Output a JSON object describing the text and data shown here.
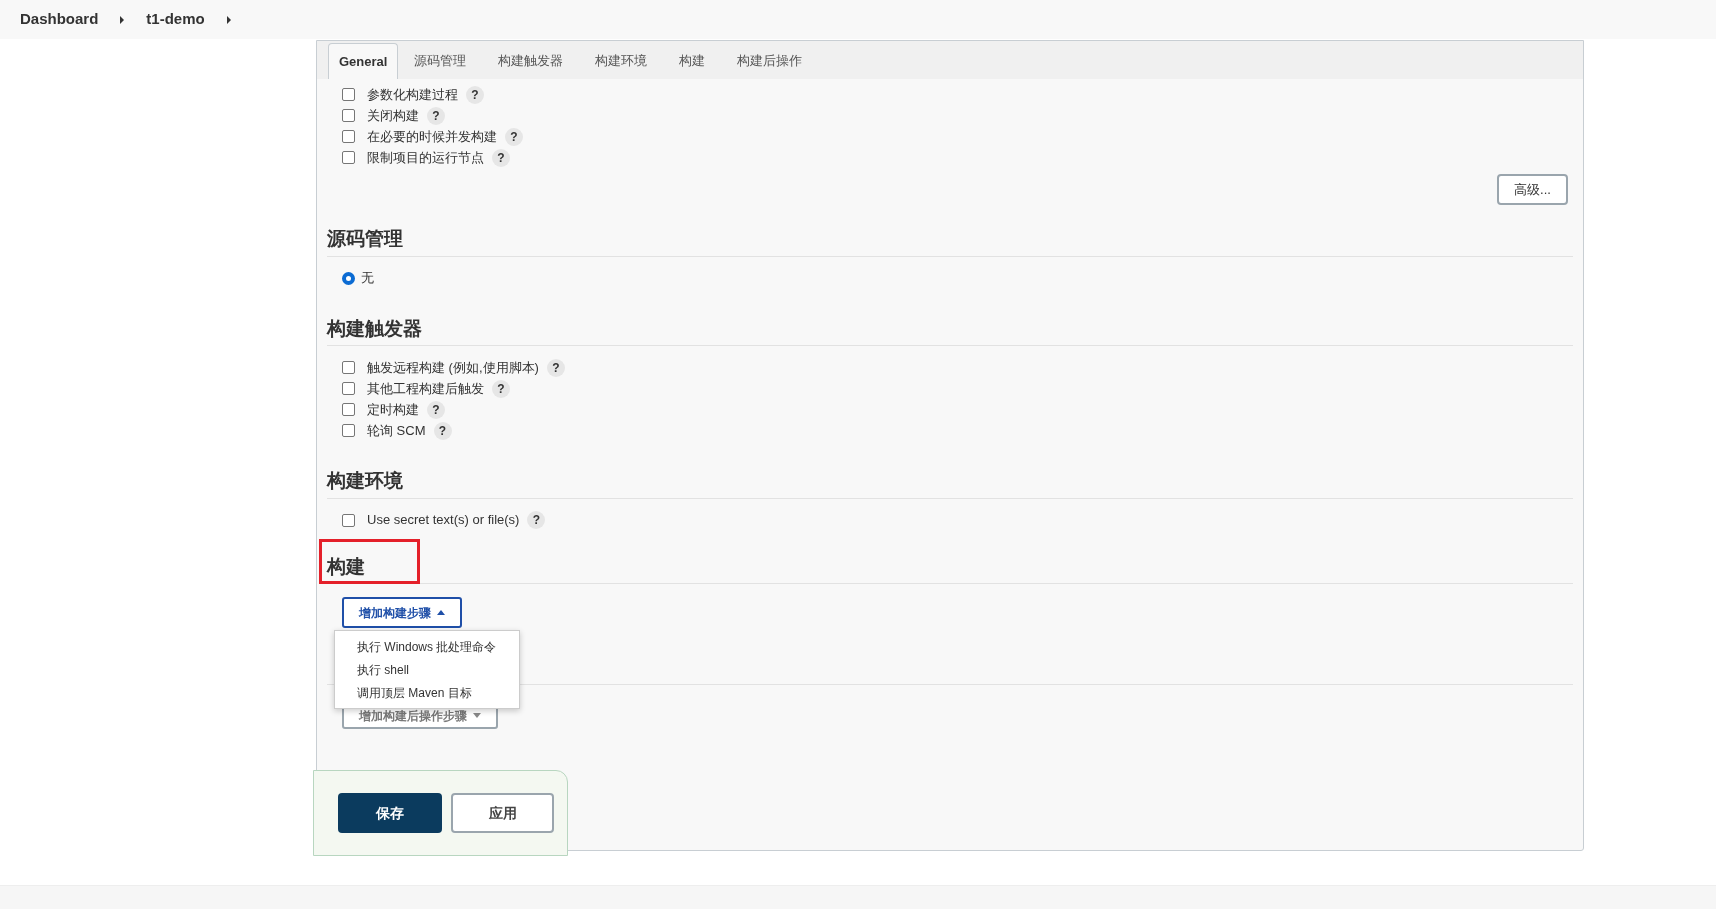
{
  "breadcrumb": [
    {
      "label": "Dashboard"
    },
    {
      "label": "t1-demo"
    }
  ],
  "tabs": [
    {
      "label": "General",
      "selected": true
    },
    {
      "label": "源码管理",
      "selected": false
    },
    {
      "label": "构建触发器",
      "selected": false
    },
    {
      "label": "构建环境",
      "selected": false
    },
    {
      "label": "构建",
      "selected": false
    },
    {
      "label": "构建后操作",
      "selected": false
    }
  ],
  "general": {
    "options": [
      {
        "label": "参数化构建过程",
        "checked": false,
        "help": "?"
      },
      {
        "label": "关闭构建",
        "checked": false,
        "help": "?"
      },
      {
        "label": "在必要的时候并发构建",
        "checked": false,
        "help": "?"
      },
      {
        "label": "限制项目的运行节点",
        "checked": false,
        "help": "?"
      }
    ],
    "advanced_button": "高级..."
  },
  "source_code": {
    "title": "源码管理",
    "options": [
      {
        "label": "无",
        "selected": true
      }
    ]
  },
  "triggers": {
    "title": "构建触发器",
    "options": [
      {
        "label": "触发远程构建 (例如,使用脚本)",
        "checked": false,
        "help": "?"
      },
      {
        "label": "其他工程构建后触发",
        "checked": false,
        "help": "?"
      },
      {
        "label": "定时构建",
        "checked": false,
        "help": "?"
      },
      {
        "label": "轮询 SCM",
        "checked": false,
        "help": "?"
      }
    ]
  },
  "environment": {
    "title": "构建环境",
    "options": [
      {
        "label": "Use secret text(s) or file(s)",
        "checked": false,
        "help": "?"
      }
    ]
  },
  "build": {
    "title": "构建",
    "highlighted": true,
    "add_step_button": "增加构建步骤",
    "menu_open": true,
    "menu": [
      {
        "label": "执行 Windows 批处理命令"
      },
      {
        "label": "执行 shell"
      },
      {
        "label": "调用顶层 Maven 目标"
      }
    ]
  },
  "post_build": {
    "add_step_button": "增加构建后操作步骤"
  },
  "actions": [
    {
      "label": "保存",
      "kind": "primary"
    },
    {
      "label": "应用",
      "kind": "secondary"
    }
  ]
}
